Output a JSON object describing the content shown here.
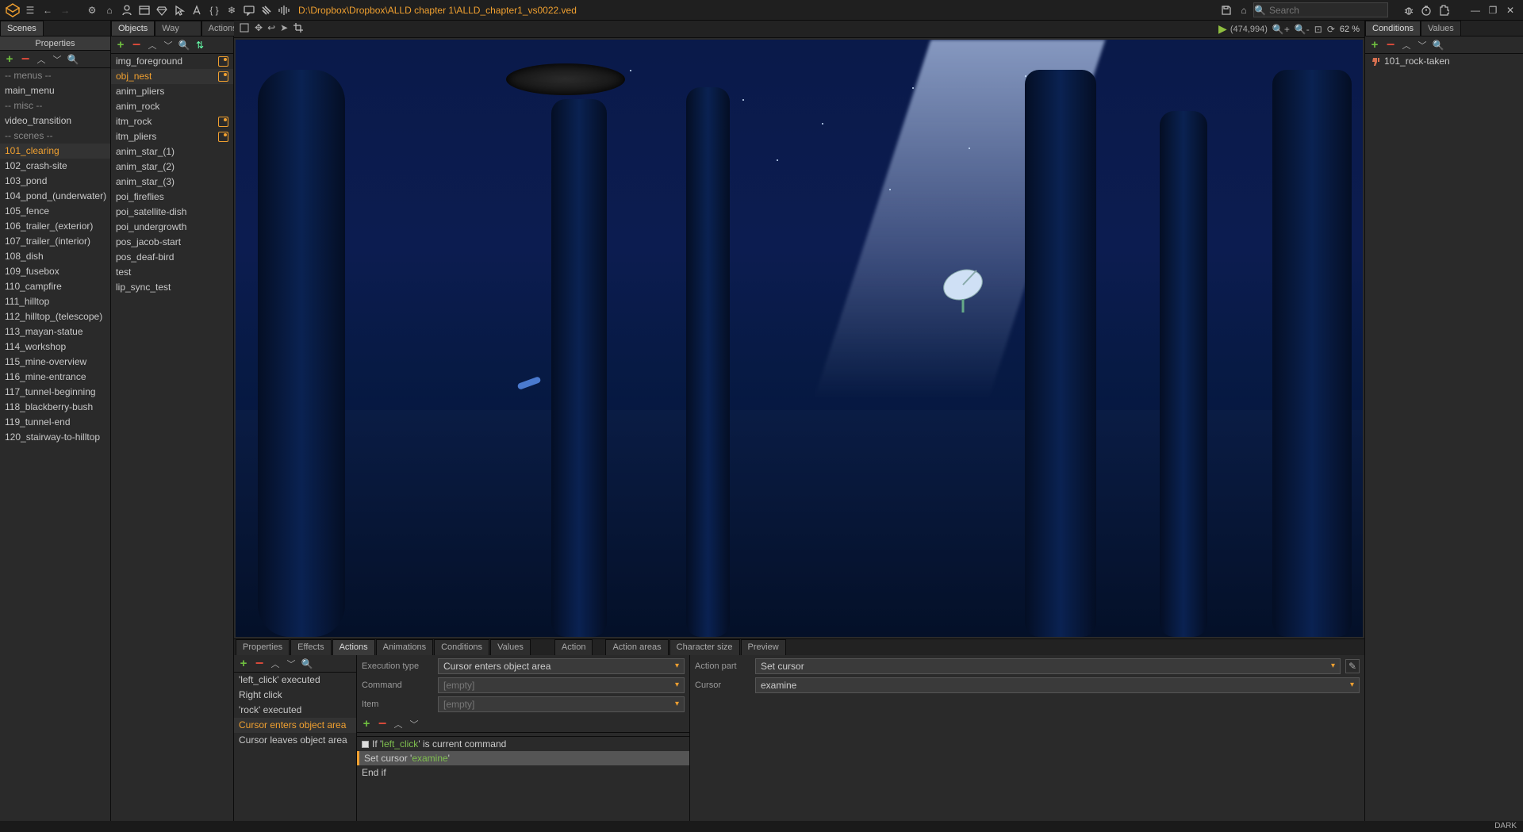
{
  "toolbar": {
    "path": "D:\\Dropbox\\Dropbox\\ALLD chapter 1\\ALLD_chapter1_vs0022.ved",
    "search_placeholder": "Search"
  },
  "left_panel": {
    "tab": "Scenes",
    "header": "Properties",
    "items": [
      {
        "label": "-- menus --",
        "hdr": true
      },
      {
        "label": "main_menu"
      },
      {
        "label": "-- misc --",
        "hdr": true
      },
      {
        "label": "video_transition"
      },
      {
        "label": "-- scenes --",
        "hdr": true
      },
      {
        "label": "101_clearing",
        "sel": true
      },
      {
        "label": "102_crash-site"
      },
      {
        "label": "103_pond"
      },
      {
        "label": "104_pond_(underwater)"
      },
      {
        "label": "105_fence"
      },
      {
        "label": "106_trailer_(exterior)"
      },
      {
        "label": "107_trailer_(interior)"
      },
      {
        "label": "108_dish"
      },
      {
        "label": "109_fusebox"
      },
      {
        "label": "110_campfire"
      },
      {
        "label": "111_hilltop"
      },
      {
        "label": "112_hilltop_(telescope)"
      },
      {
        "label": "113_mayan-statue"
      },
      {
        "label": "114_workshop"
      },
      {
        "label": "115_mine-overview"
      },
      {
        "label": "116_mine-entrance"
      },
      {
        "label": "117_tunnel-beginning"
      },
      {
        "label": "118_blackberry-bush"
      },
      {
        "label": "119_tunnel-end"
      },
      {
        "label": "120_stairway-to-hilltop"
      }
    ]
  },
  "mid_panel": {
    "tabs": [
      {
        "label": "Objects",
        "active": true
      },
      {
        "label": "Way systems"
      },
      {
        "label": "Actions"
      }
    ],
    "items": [
      {
        "label": "img_foreground",
        "img": true
      },
      {
        "label": "obj_nest",
        "img": true,
        "sel": true
      },
      {
        "label": "anim_pliers"
      },
      {
        "label": "anim_rock"
      },
      {
        "label": "itm_rock",
        "img": true
      },
      {
        "label": "itm_pliers",
        "img": true
      },
      {
        "label": "anim_star_(1)"
      },
      {
        "label": "anim_star_(2)"
      },
      {
        "label": "anim_star_(3)"
      },
      {
        "label": "poi_fireflies"
      },
      {
        "label": "poi_satellite-dish"
      },
      {
        "label": "poi_undergrowth"
      },
      {
        "label": "pos_jacob-start"
      },
      {
        "label": "pos_deaf-bird"
      },
      {
        "label": "test"
      },
      {
        "label": "lip_sync_test"
      }
    ]
  },
  "viewport": {
    "coords": "(474,994)",
    "zoom": "62 %"
  },
  "bottom": {
    "tabs": [
      {
        "label": "Properties"
      },
      {
        "label": "Effects"
      },
      {
        "label": "Actions",
        "active": true
      },
      {
        "label": "Animations"
      },
      {
        "label": "Conditions"
      },
      {
        "label": "Values"
      },
      {
        "label": "Action",
        "gap": true
      },
      {
        "label": "Action areas",
        "gap2": true
      },
      {
        "label": "Character size"
      },
      {
        "label": "Preview"
      }
    ],
    "actions_list": [
      {
        "label": "'left_click' executed"
      },
      {
        "label": "Right click"
      },
      {
        "label": "'rock' executed"
      },
      {
        "label": "Cursor enters object area",
        "sel": true
      },
      {
        "label": "Cursor leaves object area"
      }
    ],
    "form": {
      "exec_label": "Execution type",
      "exec_value": "Cursor enters object area",
      "cmd_label": "Command",
      "cmd_value": "[empty]",
      "item_label": "Item",
      "item_value": "[empty]"
    },
    "script": [
      {
        "pre": "If '",
        "kw": "left_click",
        "post": "' is current command",
        "chk": true
      },
      {
        "pre": "Set cursor '",
        "kw": "examine",
        "post": "'",
        "sel": true
      },
      {
        "pre": "End if"
      }
    ],
    "right": {
      "ap_label": "Action part",
      "ap_value": "Set cursor",
      "cur_label": "Cursor",
      "cur_value": "examine"
    }
  },
  "right_panel": {
    "tabs": [
      {
        "label": "Conditions",
        "active": true
      },
      {
        "label": "Values"
      }
    ],
    "items": [
      {
        "label": "101_rock-taken"
      }
    ]
  },
  "footer": {
    "theme": "DARK"
  }
}
